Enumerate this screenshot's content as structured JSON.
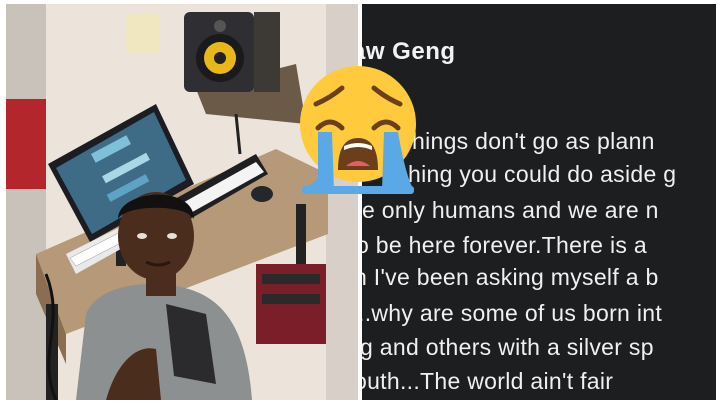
{
  "post": {
    "author_name": "aw Geng",
    "text_lines": [
      "hings don't go as plann",
      "hing you could do aside g",
      "re only humans and we are n",
      "o be here forever.There is a",
      "n I've been asking myself a b",
      "..why are some of us born int",
      "g and others with a silver sp",
      "outh...The world ain't fair"
    ]
  },
  "emoji": {
    "name": "loudly-crying-face-emoji"
  },
  "colors": {
    "post_background": "#1d1e20",
    "post_text": "#f0f0f0",
    "emoji_face": "#ffcb3d",
    "tears": "#5aa9e6"
  }
}
